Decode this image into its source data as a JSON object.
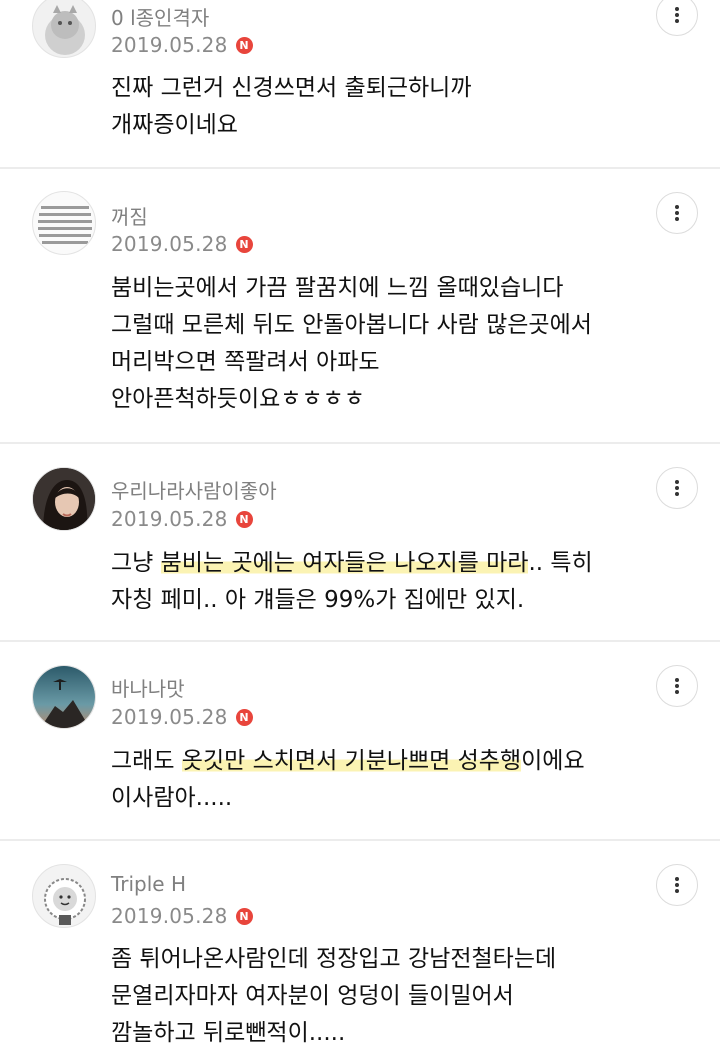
{
  "comments": [
    {
      "nickname": "0 l종인격자",
      "date": "2019.05.28",
      "badge": "N",
      "lines": [
        {
          "parts": [
            {
              "text": "진짜 그런거 신경쓰면서 출퇴근하니까",
              "hl": false
            }
          ]
        },
        {
          "parts": [
            {
              "text": "개짜증이네요",
              "hl": false
            }
          ]
        }
      ]
    },
    {
      "nickname": "꺼짐",
      "date": "2019.05.28",
      "badge": "N",
      "lines": [
        {
          "parts": [
            {
              "text": "붐비는곳에서 가끔 팔꿈치에 느낌 올때있습니다",
              "hl": false
            }
          ]
        },
        {
          "parts": [
            {
              "text": "그럴때 모른체 뒤도 안돌아봅니다 사람 많은곳에서",
              "hl": false
            }
          ]
        },
        {
          "parts": [
            {
              "text": "머리박으면 쪽팔려서 아파도",
              "hl": false
            }
          ]
        },
        {
          "parts": [
            {
              "text": "안아픈척하듯이요ㅎㅎㅎㅎ",
              "hl": false
            }
          ]
        }
      ]
    },
    {
      "nickname": "우리나라사람이좋아",
      "date": "2019.05.28",
      "badge": "N",
      "lines": [
        {
          "parts": [
            {
              "text": "그냥 ",
              "hl": false
            },
            {
              "text": "붐비는 곳에는 여자들은 나오지를 마라",
              "hl": true
            },
            {
              "text": ".. 특히",
              "hl": false
            }
          ]
        },
        {
          "parts": [
            {
              "text": "자칭 페미.. 아 걔들은 99%가 집에만 있지.",
              "hl": false
            }
          ]
        }
      ]
    },
    {
      "nickname": "바나나맛",
      "date": "2019.05.28",
      "badge": "N",
      "lines": [
        {
          "parts": [
            {
              "text": "그래도 ",
              "hl": false
            },
            {
              "text": "옷깃만 스치면서 기분나쁘면 성추행",
              "hl": true
            },
            {
              "text": "이에요",
              "hl": false
            }
          ]
        },
        {
          "parts": [
            {
              "text": "이사람아.....",
              "hl": false
            }
          ]
        }
      ]
    },
    {
      "nickname": "Triple H",
      "date": "2019.05.28",
      "badge": "N",
      "lines": [
        {
          "parts": [
            {
              "text": "좀 튀어나온사람인데 정장입고 강남전철타는데",
              "hl": false
            }
          ]
        },
        {
          "parts": [
            {
              "text": "문열리자마자 여자분이 엉덩이 들이밀어서",
              "hl": false
            }
          ]
        },
        {
          "parts": [
            {
              "text": "깜놀하고 뒤로뺀적이.....",
              "hl": false
            }
          ]
        }
      ]
    }
  ],
  "colors": {
    "badge": "#e8453c",
    "highlight": "#fbf3b3",
    "separator": "#ececec",
    "meta_text": "#8a8a8a"
  },
  "icons": {
    "more": "more-vertical-icon",
    "new_badge": "new-badge-icon"
  }
}
